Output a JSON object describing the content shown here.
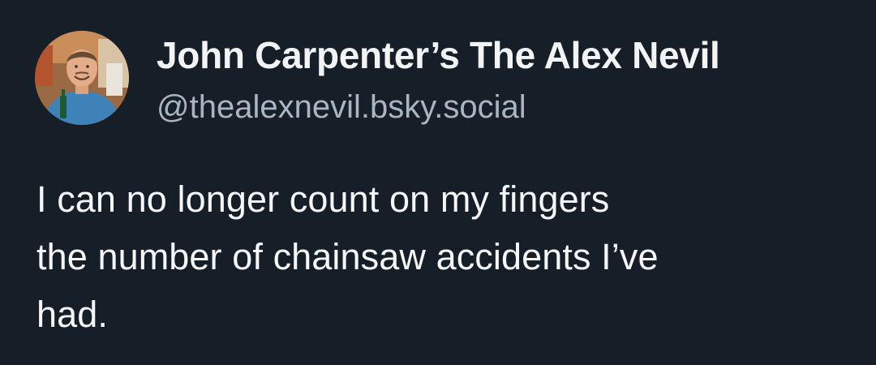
{
  "author": {
    "display_name": "John Carpenter’s The Alex Nevil",
    "handle": "@thealexnevil.bsky.social",
    "avatar_icon": "profile-photo-avatar"
  },
  "post": {
    "text": "I can no longer count on my fingers\nthe number of chainsaw accidents I’ve\nhad."
  },
  "colors": {
    "background": "#161e27",
    "primary_text": "#f1f3f5",
    "secondary_text": "#a9b5c3"
  }
}
